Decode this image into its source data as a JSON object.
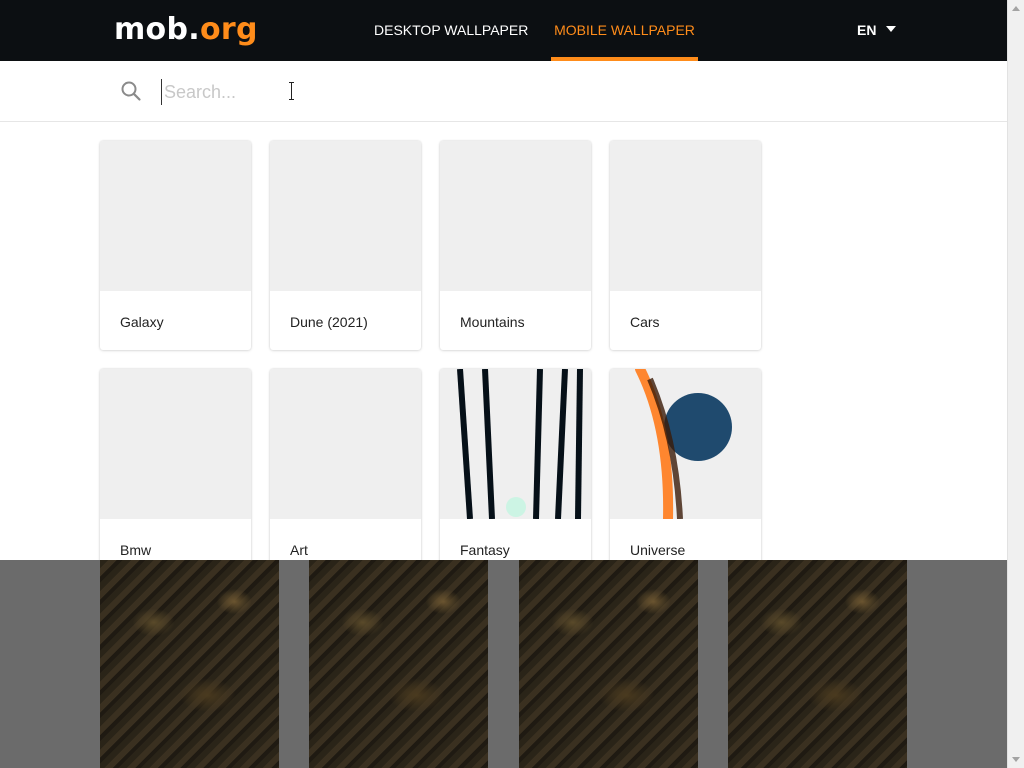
{
  "header": {
    "logo_part1": "mob.",
    "logo_part2": "org",
    "nav": {
      "desktop": "DESKTOP WALLPAPER",
      "mobile": "MOBILE WALLPAPER"
    },
    "language": "EN"
  },
  "search": {
    "placeholder": "Search...",
    "value": ""
  },
  "categories": [
    {
      "label": "Galaxy"
    },
    {
      "label": "Dune (2021)"
    },
    {
      "label": "Mountains"
    },
    {
      "label": "Cars"
    },
    {
      "label": "Bmw"
    },
    {
      "label": "Art"
    },
    {
      "label": "Fantasy"
    },
    {
      "label": "Universe"
    }
  ],
  "colors": {
    "header_bg": "#0c0f12",
    "accent": "#ff8c1a",
    "overlay": "#6b6b6b"
  }
}
